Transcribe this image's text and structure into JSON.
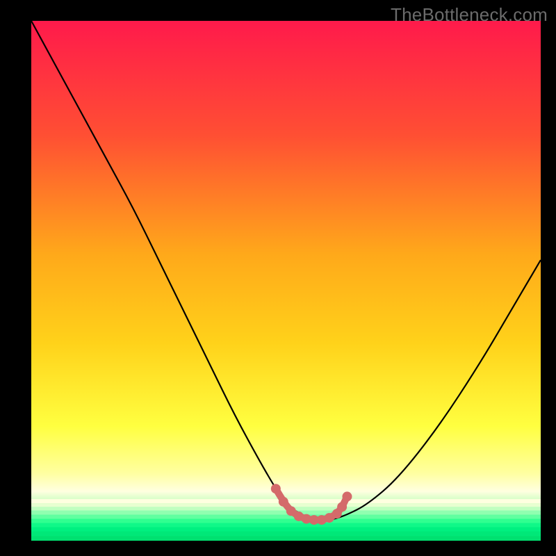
{
  "watermark": "TheBottleneck.com",
  "chart_data": {
    "type": "line",
    "title": "",
    "xlabel": "",
    "ylabel": "",
    "xlim": [
      0,
      100
    ],
    "ylim": [
      0,
      100
    ],
    "background_gradient": {
      "stops": [
        {
          "offset": 0.0,
          "color": "#ff1a4b"
        },
        {
          "offset": 0.22,
          "color": "#ff4f33"
        },
        {
          "offset": 0.45,
          "color": "#ffa91a"
        },
        {
          "offset": 0.62,
          "color": "#ffd21a"
        },
        {
          "offset": 0.78,
          "color": "#ffff40"
        },
        {
          "offset": 0.87,
          "color": "#ffffa0"
        },
        {
          "offset": 0.905,
          "color": "#ffffe0"
        },
        {
          "offset": 0.92,
          "color": "#d8ffc8"
        },
        {
          "offset": 0.94,
          "color": "#80ffb0"
        },
        {
          "offset": 0.97,
          "color": "#00ff8f"
        },
        {
          "offset": 1.0,
          "color": "#00e878"
        }
      ],
      "bands": [
        {
          "y": 92.0,
          "color": "#ffffe0"
        },
        {
          "y": 92.8,
          "color": "#e8ffd0"
        },
        {
          "y": 93.5,
          "color": "#c0ffc0"
        },
        {
          "y": 94.2,
          "color": "#90ffb0"
        },
        {
          "y": 95.0,
          "color": "#60ffa0"
        },
        {
          "y": 95.8,
          "color": "#30ff90"
        },
        {
          "y": 96.6,
          "color": "#10f888"
        },
        {
          "y": 97.4,
          "color": "#00f080"
        },
        {
          "y": 98.2,
          "color": "#00e878"
        },
        {
          "y": 99.1,
          "color": "#00e070"
        }
      ]
    },
    "curve": {
      "x": [
        0,
        5,
        10,
        15,
        20,
        25,
        30,
        35,
        40,
        45,
        48,
        50,
        53,
        56,
        59,
        62,
        66,
        72,
        80,
        88,
        94,
        100
      ],
      "y_pct": [
        0,
        9,
        18,
        27,
        36,
        46,
        56,
        66,
        76,
        85,
        90,
        93,
        95,
        96,
        96,
        95,
        93,
        88,
        78,
        66,
        56,
        46
      ]
    },
    "highlight": {
      "x": [
        48.0,
        49.5,
        51.0,
        52.5,
        54.0,
        55.5,
        57.0,
        58.5,
        60.0,
        61.0,
        62.0
      ],
      "y_pct": [
        90.0,
        92.5,
        94.3,
        95.3,
        95.8,
        96.0,
        96.0,
        95.6,
        94.8,
        93.5,
        91.5
      ],
      "color": "#d46a6a",
      "dot_radius": 7
    },
    "curve_style": {
      "stroke": "#000000",
      "width": 2.2
    }
  }
}
